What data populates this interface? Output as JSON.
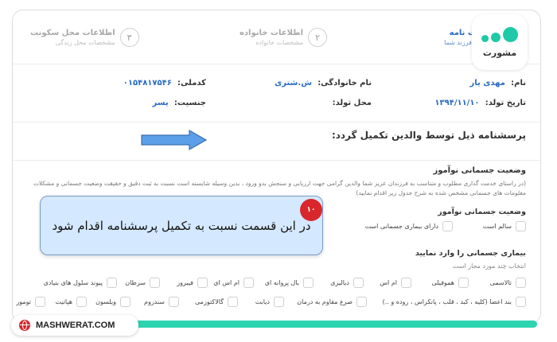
{
  "stepper": {
    "steps": [
      {
        "num": "۱",
        "title": "اطلاعات نامه",
        "subtitle": "مشخصات فرزند شما"
      },
      {
        "num": "۲",
        "title": "اطلاعات خانواده",
        "subtitle": "مشخصات خانواده"
      },
      {
        "num": "۳",
        "title": "اطلاعات محل سکونت",
        "subtitle": "مشخصات محل زندگی"
      }
    ]
  },
  "info": {
    "name_label": "نام:",
    "name_value": "مهدی یار",
    "family_label": "نام خانوادگی:",
    "family_value": "ش.شتری",
    "code_label": "کدملی:",
    "code_value": "۰۱۵۴۸۱۷۵۴۶",
    "birth_date_label": "تاریخ تولد:",
    "birth_date_value": "۱۳۹۴/۱۱/۱۰",
    "birth_place_label": "محل تولد:",
    "birth_place_value": "",
    "gender_label": "جنسیت:",
    "gender_value": "پسر"
  },
  "instruction": "پرسشنامه ذیل توسط والدین تکمیل گردد:",
  "section": {
    "title": "وضعیت جسمانی نوآموز",
    "description": "(در راستای خدمت گذاری مطلوب و متناسب به فرزندان عزیز شما والدین گرامی جهت ارزیابی و سنجش بدو ورود ، بدین وسیله شایسته است نسبت به ثبت دقیق و حقیقت وضعیت جسمانی و مشکلات معلومات های جسمانی مشخص شده به شرح جدول زیر اقدام نمایید)"
  },
  "health_status": {
    "title": "وضعیت جسمانی نوآموز",
    "options": [
      "سالم است",
      "دارای بیماری جسمانی است"
    ]
  },
  "diseases": {
    "title": "بیماری جسمانی را وارد نمایید",
    "note": "انتخاب چند مورد مجاز است",
    "row1": [
      "تالاسمی",
      "هموفیلی",
      "ام اس",
      "دیالیزی",
      "بال پروانه ای",
      "ام اس ای",
      "فیبروز",
      "سرطان",
      "پیوند سلول های بنیادی"
    ],
    "row2": [
      "بند اعضا (کلیه ، کبد ، قلب ، پانکراس ، روده و ..)",
      "صرع مقاوم به درمان",
      "دیابت",
      "گالاکتوزمی",
      "سندروم",
      "ویلسون",
      "هپاتیت",
      "تومور"
    ]
  },
  "callout": {
    "text": "در این قسمت نسبت به تکمیل پرسشنامه اقدام شود",
    "badge": "۱۰"
  },
  "brand": {
    "logo_word": "مشورت",
    "site": "MASHWERAT.COM"
  },
  "colors": {
    "accent": "#2b6cc4",
    "callout_bg": "#d4e8ff",
    "badge": "#d8262c",
    "brand_green": "#2dd4b1"
  }
}
